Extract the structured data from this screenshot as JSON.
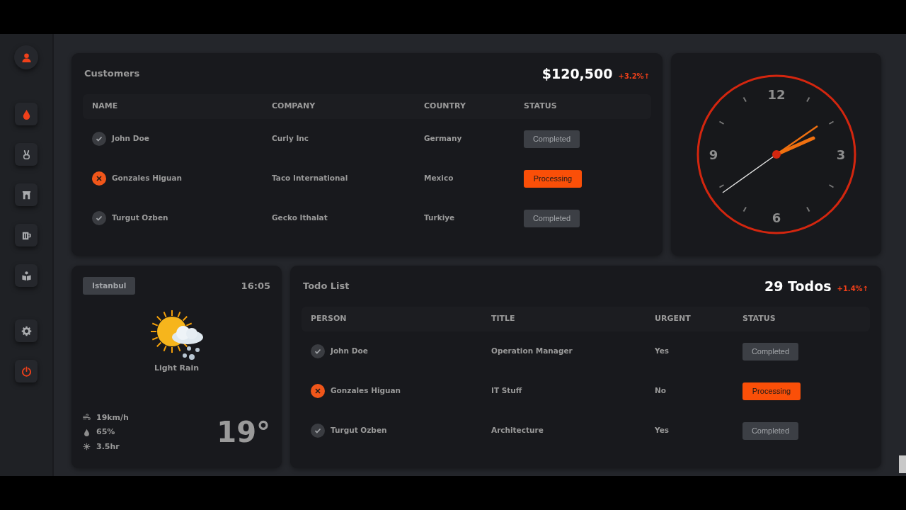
{
  "sidebar": {
    "avatar": {
      "kind": "user"
    },
    "items": [
      {
        "kind": "drop",
        "accent": true
      },
      {
        "kind": "peace",
        "accent": false
      },
      {
        "kind": "arch",
        "accent": false
      },
      {
        "kind": "mug",
        "accent": false
      },
      {
        "kind": "reader",
        "accent": false
      },
      {
        "kind": "gear",
        "accent": false
      },
      {
        "kind": "power",
        "accent": true
      }
    ]
  },
  "customers": {
    "title": "Customers",
    "total": "$120,500",
    "change": "+3.2%↑",
    "columns": [
      "NAME",
      "COMPANY",
      "COUNTRY",
      "STATUS"
    ],
    "rows": [
      {
        "done": true,
        "cells": [
          "John Doe",
          "Curly Inc",
          "Germany"
        ],
        "status": {
          "kind": "completed",
          "label": "Completed"
        }
      },
      {
        "done": false,
        "cells": [
          "Gonzales Higuan",
          "Taco International",
          "Mexico"
        ],
        "status": {
          "kind": "processing",
          "label": "Processing"
        }
      },
      {
        "done": true,
        "cells": [
          "Turgut Ozben",
          "Gecko Ithalat",
          "Turkiye"
        ],
        "status": {
          "kind": "completed",
          "label": "Completed"
        }
      }
    ]
  },
  "clock": {
    "numerals": [
      "12",
      "3",
      "6",
      "9"
    ]
  },
  "weather": {
    "city": "Istanbul",
    "time": "16:05",
    "condition": "Light Rain",
    "temperature": "19°",
    "stats": [
      {
        "kind": "wind",
        "value": "19km/h"
      },
      {
        "kind": "humidity",
        "value": "65%"
      },
      {
        "kind": "sun",
        "value": "3.5hr"
      }
    ]
  },
  "todos": {
    "title": "Todo List",
    "total": "29 Todos",
    "change": "+1.4%↑",
    "columns": [
      "PERSON",
      "TITLE",
      "URGENT",
      "STATUS"
    ],
    "rows": [
      {
        "done": true,
        "cells": [
          "John Doe",
          "Operation Manager",
          "Yes"
        ],
        "status": {
          "kind": "completed",
          "label": "Completed"
        }
      },
      {
        "done": false,
        "cells": [
          "Gonzales Higuan",
          "IT Stuff",
          "No"
        ],
        "status": {
          "kind": "processing",
          "label": "Processing"
        }
      },
      {
        "done": true,
        "cells": [
          "Turgut Ozben",
          "Architecture",
          "Yes"
        ],
        "status": {
          "kind": "completed",
          "label": "Completed"
        }
      }
    ]
  }
}
